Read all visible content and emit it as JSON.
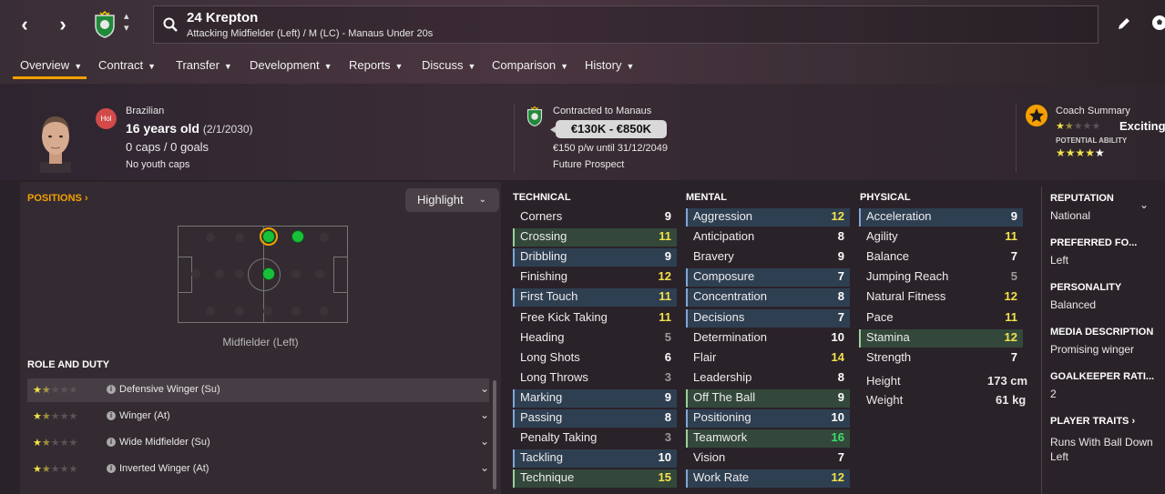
{
  "header": {
    "name": "24 Krepton",
    "subtitle": "Attacking Midfielder (Left) / M (LC) - Manaus Under 20s"
  },
  "tabs": [
    {
      "label": "Overview"
    },
    {
      "label": "Contract"
    },
    {
      "label": "Transfer"
    },
    {
      "label": "Development"
    },
    {
      "label": "Reports"
    },
    {
      "label": "Discuss"
    },
    {
      "label": "Comparison"
    },
    {
      "label": "History"
    }
  ],
  "player": {
    "nationality": "Brazilian",
    "nation_code": "Hol",
    "age": "16 years old",
    "dob": "(2/1/2030)",
    "caps": "0 caps / 0 goals",
    "youth": "No youth caps"
  },
  "contract": {
    "club": "Contracted to Manaus",
    "value": "€130K - €850K",
    "wage": "€150 p/w until 31/12/2049",
    "status": "Future Prospect"
  },
  "coach": {
    "title": "Coach Summary",
    "rating_word": "Exciting",
    "potential_label": "POTENTIAL ABILITY"
  },
  "positions": {
    "title": "POSITIONS",
    "highlight": "Highlight",
    "label": "Midfielder (Left)"
  },
  "roles": {
    "title": "ROLE AND DUTY",
    "items": [
      {
        "name": "Defensive Winger (Su)"
      },
      {
        "name": "Winger (At)"
      },
      {
        "name": "Wide Midfielder (Su)"
      },
      {
        "name": "Inverted Winger (At)"
      }
    ]
  },
  "technical": {
    "title": "TECHNICAL",
    "items": [
      {
        "name": "Corners",
        "value": "9"
      },
      {
        "name": "Crossing",
        "value": "11"
      },
      {
        "name": "Dribbling",
        "value": "9"
      },
      {
        "name": "Finishing",
        "value": "12"
      },
      {
        "name": "First Touch",
        "value": "11"
      },
      {
        "name": "Free Kick Taking",
        "value": "11"
      },
      {
        "name": "Heading",
        "value": "5"
      },
      {
        "name": "Long Shots",
        "value": "6"
      },
      {
        "name": "Long Throws",
        "value": "3"
      },
      {
        "name": "Marking",
        "value": "9"
      },
      {
        "name": "Passing",
        "value": "8"
      },
      {
        "name": "Penalty Taking",
        "value": "3"
      },
      {
        "name": "Tackling",
        "value": "10"
      },
      {
        "name": "Technique",
        "value": "15"
      }
    ]
  },
  "mental": {
    "title": "MENTAL",
    "items": [
      {
        "name": "Aggression",
        "value": "12"
      },
      {
        "name": "Anticipation",
        "value": "8"
      },
      {
        "name": "Bravery",
        "value": "9"
      },
      {
        "name": "Composure",
        "value": "7"
      },
      {
        "name": "Concentration",
        "value": "8"
      },
      {
        "name": "Decisions",
        "value": "7"
      },
      {
        "name": "Determination",
        "value": "10"
      },
      {
        "name": "Flair",
        "value": "14"
      },
      {
        "name": "Leadership",
        "value": "8"
      },
      {
        "name": "Off The Ball",
        "value": "9"
      },
      {
        "name": "Positioning",
        "value": "10"
      },
      {
        "name": "Teamwork",
        "value": "16"
      },
      {
        "name": "Vision",
        "value": "7"
      },
      {
        "name": "Work Rate",
        "value": "12"
      }
    ]
  },
  "physical": {
    "title": "PHYSICAL",
    "items": [
      {
        "name": "Acceleration",
        "value": "9"
      },
      {
        "name": "Agility",
        "value": "11"
      },
      {
        "name": "Balance",
        "value": "7"
      },
      {
        "name": "Jumping Reach",
        "value": "5"
      },
      {
        "name": "Natural Fitness",
        "value": "12"
      },
      {
        "name": "Pace",
        "value": "11"
      },
      {
        "name": "Stamina",
        "value": "12"
      },
      {
        "name": "Strength",
        "value": "7"
      }
    ],
    "height_label": "Height",
    "height": "173 cm",
    "weight_label": "Weight",
    "weight": "61 kg"
  },
  "side": {
    "reputation_t": "REPUTATION",
    "reputation": "National",
    "foot_t": "PREFERRED FO...",
    "foot": "Left",
    "personality_t": "PERSONALITY",
    "personality": "Balanced",
    "media_t": "MEDIA DESCRIPTION",
    "media": "Promising winger",
    "gk_t": "GOALKEEPER RATI...",
    "gk": "2",
    "traits_t": "PLAYER TRAITS",
    "traits": "Runs With Ball Down Left"
  },
  "colors": {
    "accent": "#f5a000",
    "high": "#f2e24a",
    "vhigh": "#3ee06a",
    "low": "#9a9a9a",
    "normal": "#ffffff"
  }
}
